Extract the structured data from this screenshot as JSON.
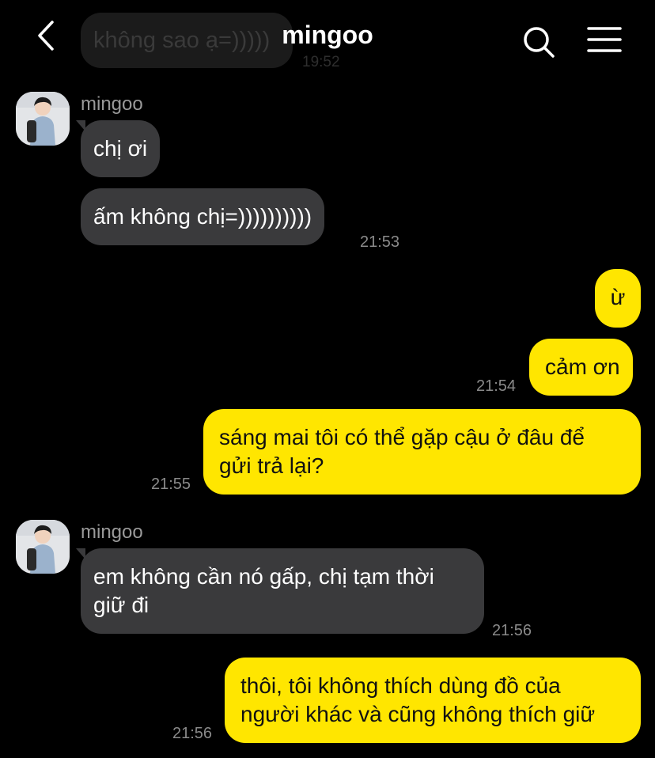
{
  "header": {
    "title": "mingoo",
    "back_icon": "chevron-left-icon",
    "search_icon": "search-icon",
    "menu_icon": "hamburger-menu-icon"
  },
  "colors": {
    "background": "#000000",
    "incoming_bubble": "#3a3a3c",
    "outgoing_bubble": "#ffe600",
    "timestamp": "#8a8a8a"
  },
  "ghost_message": {
    "text": "không sao ạ=)))))",
    "time": "19:52"
  },
  "messages": [
    {
      "sender": "mingoo",
      "text": "chị ơi"
    },
    {
      "text": "ấm không chị=))))))))))",
      "time": "21:53"
    },
    {
      "text": "ừ"
    },
    {
      "text": "cảm ơn",
      "time": "21:54"
    },
    {
      "lines": [
        "sáng mai tôi có thể gặp cậu ở đâu để",
        "gửi trả lại?"
      ],
      "time": "21:55"
    },
    {
      "sender": "mingoo",
      "lines": [
        "em không cần nó gấp, chị tạm thời",
        "giữ đi"
      ],
      "time": "21:56"
    },
    {
      "lines": [
        "thôi, tôi không thích dùng đồ của",
        "người khác và cũng không thích giữ"
      ],
      "time": "21:56"
    }
  ]
}
